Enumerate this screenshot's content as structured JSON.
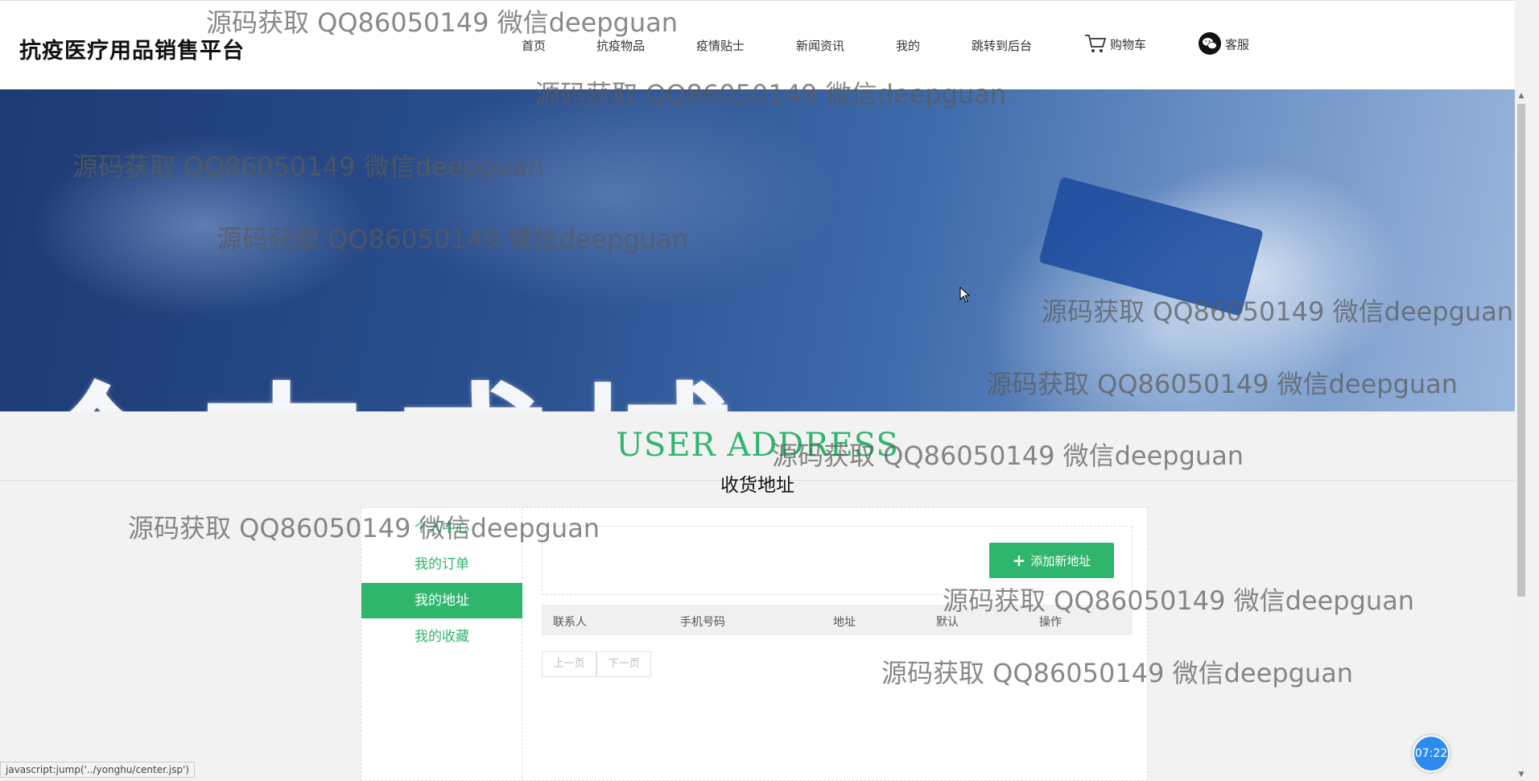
{
  "header": {
    "brand": "抗疫医疗用品销售平台",
    "nav": [
      {
        "label": "首页"
      },
      {
        "label": "抗疫物品"
      },
      {
        "label": "疫情贴士"
      },
      {
        "label": "新闻资讯"
      },
      {
        "label": "我的"
      },
      {
        "label": "跳转到后台"
      },
      {
        "label": "购物车",
        "icon": "cart-icon"
      },
      {
        "label": "客服",
        "icon": "wechat-icon"
      }
    ]
  },
  "banner": {
    "text": "众志成城"
  },
  "section": {
    "title_en": "USER ADDRESS",
    "title_cn": "收货地址"
  },
  "sidebar": {
    "items": [
      {
        "label": "个人中心",
        "active": false
      },
      {
        "label": "我的订单",
        "active": false
      },
      {
        "label": "我的地址",
        "active": true
      },
      {
        "label": "我的收藏",
        "active": false
      }
    ]
  },
  "main": {
    "add_button": "添加新地址",
    "table_headers": [
      "联系人",
      "手机号码",
      "地址",
      "默认",
      "操作"
    ],
    "pager": {
      "prev": "上一页",
      "next": "下一页"
    }
  },
  "watermark": "源码获取 QQ86050149 微信deepguan",
  "status_url": "javascript:jump('../yonghu/center.jsp')",
  "timer": "07:22",
  "colors": {
    "accent": "#2fb56c",
    "timer": "#2d8bf0"
  }
}
